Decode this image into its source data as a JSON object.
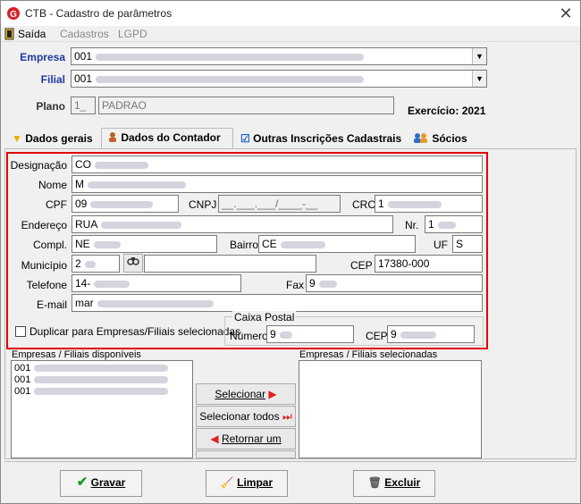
{
  "window": {
    "title": "CTB - Cadastro de parâmetros"
  },
  "menu": {
    "exit": "Saída",
    "cadastros": "Cadastros",
    "lgpd": "LGPD"
  },
  "header": {
    "empresa_label": "Empresa",
    "empresa_code": "001",
    "filial_label": "Filial",
    "filial_code": "001",
    "plano_label": "Plano",
    "plano_code": "1_",
    "plano_name": "PADRAO",
    "exercicio": "Exercício: 2021"
  },
  "tabs": [
    {
      "label": "Dados gerais"
    },
    {
      "label": "Dados do Contador"
    },
    {
      "label": "Outras Inscrições Cadastrais"
    },
    {
      "label": "Sócios"
    }
  ],
  "form": {
    "designacao_label": "Designação",
    "designacao_value": "CO",
    "nome_label": "Nome",
    "nome_value": "M",
    "cpf_label": "CPF",
    "cpf_value": "09",
    "cnpj_label": "CNPJ",
    "cnpj_value": "__.___.___/____-__",
    "crc_label": "CRC",
    "crc_value": "1",
    "endereco_label": "Endereço",
    "endereco_value": "RUA",
    "nr_label": "Nr.",
    "nr_value": "1",
    "compl_label": "Compl.",
    "compl_value": "NE",
    "bairro_label": "Bairro",
    "bairro_value": "CE",
    "uf_label": "UF",
    "uf_value": "S",
    "municipio_label": "Município",
    "municipio_value": "2",
    "cep_label": "CEP",
    "cep_value": "17380-000",
    "telefone_label": "Telefone",
    "telefone_value": "14-",
    "fax_label": "Fax",
    "fax_value": "9",
    "email_label": "E-mail",
    "email_value": "mar",
    "duplicar_label": "Duplicar para Empresas/Filiais selecionadas",
    "caixa_postal_label": "Caixa Postal",
    "numero_label": "Número",
    "numero_value": "9",
    "cp_cep_label": "CEP",
    "cp_cep_value": "9"
  },
  "lists": {
    "disponiveis_label": "Empresas / Filiais disponíveis",
    "selecionadas_label": "Empresas / Filiais selecionadas",
    "disponiveis_items": [
      "001",
      "001",
      "001"
    ]
  },
  "transfer_buttons": {
    "selecionar": "Selecionar",
    "selecionar_todos": "Selecionar todos",
    "retornar_um": "Retornar um"
  },
  "bottom_buttons": {
    "gravar": "Gravar",
    "limpar": "Limpar",
    "excluir": "Excluir"
  },
  "colors": {
    "accent_red": "#e00000",
    "label_blue": "#1e3aa0"
  }
}
